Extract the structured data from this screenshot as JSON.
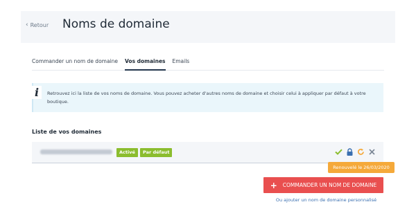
{
  "header": {
    "back_label": "Retour",
    "title": "Noms de domaine"
  },
  "tabs": [
    {
      "label": "Commander un nom de domaine",
      "active": false
    },
    {
      "label": "Vos domaines",
      "active": true
    },
    {
      "label": "Emails",
      "active": false
    }
  ],
  "info": {
    "icon": "info-icon",
    "text": "Retrouvez ici la liste de vos noms de domaine. Vous pouvez acheter d'autres noms de domaine et choisir celui à appliquer par défaut à votre boutique."
  },
  "domains": {
    "title": "Liste de vos domaines",
    "items": [
      {
        "status_badge": "Activé",
        "default_badge": "Par défaut",
        "actions": [
          "check-icon",
          "lock-icon",
          "renew-icon",
          "close-icon"
        ],
        "tooltip": "Renouvelé le 26/03/2020"
      }
    ]
  },
  "order_button": {
    "label": "COMMANDER UN NOM DE DOMAINE"
  },
  "custom_domain": {
    "prefix": "Ou ",
    "link": "ajouter un nom de domaine personnalisé"
  },
  "colors": {
    "accent_red": "#e94f4f",
    "badge_green": "#8bbd2e",
    "tooltip_orange": "#f5a93a",
    "check_green": "#8bbd2e",
    "lock_blue": "#3a6fb0",
    "info_bg": "#eaf6fb"
  }
}
